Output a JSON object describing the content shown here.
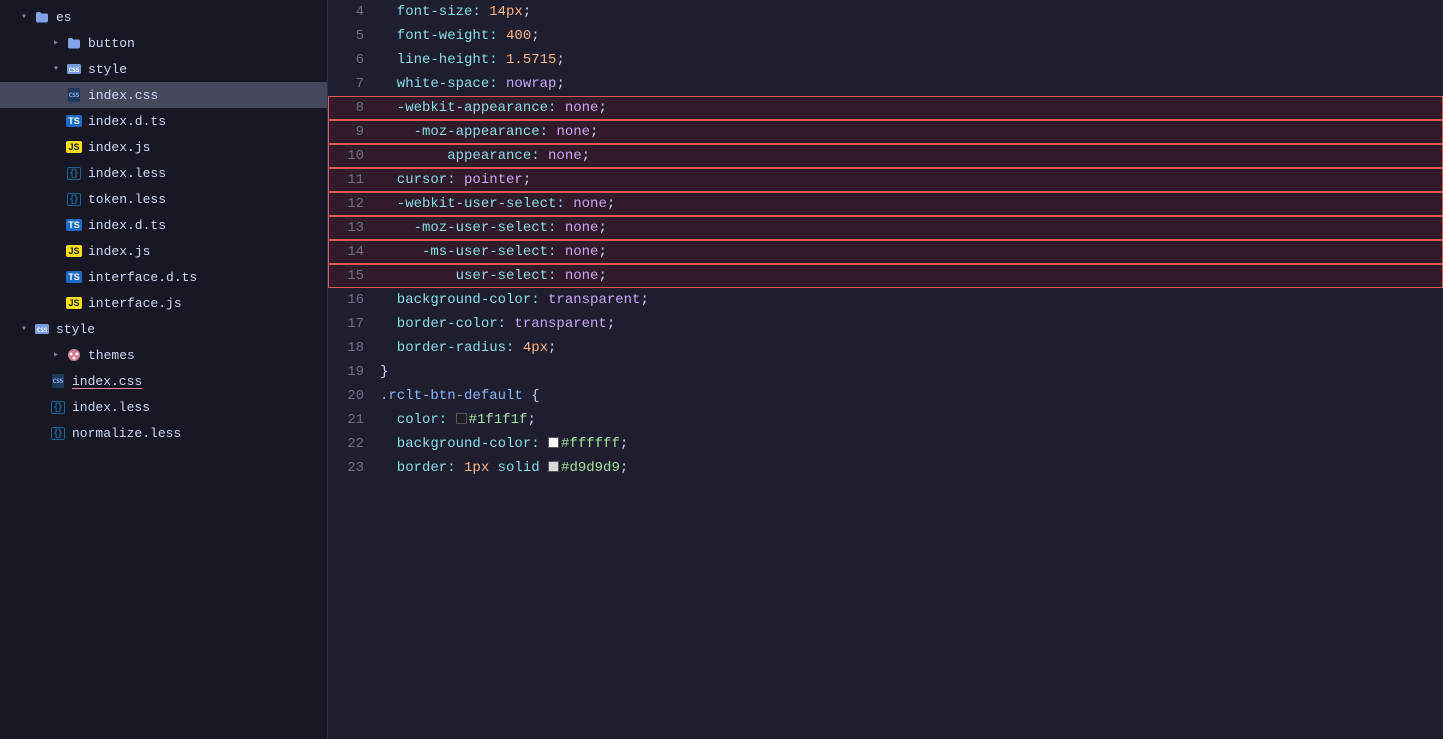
{
  "sidebar": {
    "items": [
      {
        "id": "es-folder",
        "label": "es",
        "type": "folder",
        "icon": "folder",
        "indent": 1,
        "state": "open",
        "depth": 1
      },
      {
        "id": "button-folder",
        "label": "button",
        "type": "folder",
        "icon": "folder",
        "indent": 2,
        "state": "closed",
        "depth": 2
      },
      {
        "id": "style-folder-1",
        "label": "style",
        "type": "folder",
        "icon": "folder-css",
        "indent": 2,
        "state": "open",
        "depth": 2
      },
      {
        "id": "index-css-1",
        "label": "index.css",
        "type": "css",
        "icon": "css",
        "indent": 3,
        "active": true,
        "depth": 3
      },
      {
        "id": "index-d-ts-1",
        "label": "index.d.ts",
        "type": "ts",
        "icon": "ts",
        "indent": 3,
        "depth": 3
      },
      {
        "id": "index-js-1",
        "label": "index.js",
        "type": "js",
        "icon": "js",
        "indent": 3,
        "depth": 3
      },
      {
        "id": "index-less-1",
        "label": "index.less",
        "type": "less",
        "icon": "less",
        "indent": 3,
        "depth": 3
      },
      {
        "id": "token-less-1",
        "label": "token.less",
        "type": "less",
        "icon": "less",
        "indent": 3,
        "depth": 3
      },
      {
        "id": "index-d-ts-2",
        "label": "index.d.ts",
        "type": "ts",
        "icon": "ts",
        "indent": 3,
        "depth": 3
      },
      {
        "id": "index-js-2",
        "label": "index.js",
        "type": "js",
        "icon": "js",
        "indent": 3,
        "depth": 3
      },
      {
        "id": "interface-d-ts",
        "label": "interface.d.ts",
        "type": "ts",
        "icon": "ts",
        "indent": 3,
        "depth": 3
      },
      {
        "id": "interface-js",
        "label": "interface.js",
        "type": "js",
        "icon": "js",
        "indent": 3,
        "depth": 3
      },
      {
        "id": "style-folder-2",
        "label": "style",
        "type": "folder",
        "icon": "folder-css",
        "indent": 1,
        "state": "open",
        "depth": 1
      },
      {
        "id": "themes-folder",
        "label": "themes",
        "type": "folder",
        "icon": "themes",
        "indent": 2,
        "state": "closed",
        "depth": 2
      },
      {
        "id": "index-css-2",
        "label": "index.css",
        "type": "css",
        "icon": "css",
        "indent": 2,
        "underline": true,
        "depth": 2
      },
      {
        "id": "index-less-2",
        "label": "index.less",
        "type": "less",
        "icon": "less",
        "indent": 2,
        "depth": 2
      },
      {
        "id": "normalize-less",
        "label": "normalize.less",
        "type": "less",
        "icon": "less",
        "indent": 2,
        "depth": 2
      }
    ]
  },
  "editor": {
    "lines": [
      {
        "num": 4,
        "tokens": [
          {
            "text": "  font-size: ",
            "class": "prop"
          },
          {
            "text": "14px",
            "class": "val-num"
          },
          {
            "text": ";",
            "class": "semicolon"
          }
        ]
      },
      {
        "num": 5,
        "tokens": [
          {
            "text": "  font-weight: ",
            "class": "prop"
          },
          {
            "text": "400",
            "class": "val-num"
          },
          {
            "text": ";",
            "class": "semicolon"
          }
        ]
      },
      {
        "num": 6,
        "tokens": [
          {
            "text": "  line-height: ",
            "class": "prop"
          },
          {
            "text": "1.5715",
            "class": "val-num"
          },
          {
            "text": ";",
            "class": "semicolon"
          }
        ]
      },
      {
        "num": 7,
        "tokens": [
          {
            "text": "  white-space: ",
            "class": "prop"
          },
          {
            "text": "nowrap",
            "class": "val-none"
          },
          {
            "text": ";",
            "class": "semicolon"
          }
        ]
      },
      {
        "num": 8,
        "tokens": [
          {
            "text": "  -webkit-appearance: ",
            "class": "prop"
          },
          {
            "text": "none",
            "class": "val-none"
          },
          {
            "text": ";",
            "class": "semicolon"
          }
        ],
        "highlight": true
      },
      {
        "num": 9,
        "tokens": [
          {
            "text": "    -moz-appearance: ",
            "class": "prop"
          },
          {
            "text": "none",
            "class": "val-none"
          },
          {
            "text": ";",
            "class": "semicolon"
          }
        ],
        "highlight": true
      },
      {
        "num": 10,
        "tokens": [
          {
            "text": "        appearance: ",
            "class": "prop"
          },
          {
            "text": "none",
            "class": "val-none"
          },
          {
            "text": ";",
            "class": "semicolon"
          }
        ],
        "highlight": true
      },
      {
        "num": 11,
        "tokens": [
          {
            "text": "  cursor: ",
            "class": "prop"
          },
          {
            "text": "pointer",
            "class": "val-none"
          },
          {
            "text": ";",
            "class": "semicolon"
          }
        ],
        "highlight": true
      },
      {
        "num": 12,
        "tokens": [
          {
            "text": "  -webkit-user-select: ",
            "class": "prop"
          },
          {
            "text": "none",
            "class": "val-none"
          },
          {
            "text": ";",
            "class": "semicolon"
          }
        ],
        "highlight": true
      },
      {
        "num": 13,
        "tokens": [
          {
            "text": "    -moz-user-select: ",
            "class": "prop"
          },
          {
            "text": "none",
            "class": "val-none"
          },
          {
            "text": ";",
            "class": "semicolon"
          }
        ],
        "highlight": true
      },
      {
        "num": 14,
        "tokens": [
          {
            "text": "     -ms-user-select: ",
            "class": "prop"
          },
          {
            "text": "none",
            "class": "val-none"
          },
          {
            "text": ";",
            "class": "semicolon"
          }
        ],
        "highlight": true
      },
      {
        "num": 15,
        "tokens": [
          {
            "text": "         user-select: ",
            "class": "prop"
          },
          {
            "text": "none",
            "class": "val-none"
          },
          {
            "text": ";",
            "class": "semicolon"
          }
        ],
        "highlight": true
      },
      {
        "num": 16,
        "tokens": [
          {
            "text": "  background-color: ",
            "class": "prop"
          },
          {
            "text": "transparent",
            "class": "val-none"
          },
          {
            "text": ";",
            "class": "semicolon"
          }
        ]
      },
      {
        "num": 17,
        "tokens": [
          {
            "text": "  border-color: ",
            "class": "prop"
          },
          {
            "text": "transparent",
            "class": "val-none"
          },
          {
            "text": ";",
            "class": "semicolon"
          }
        ]
      },
      {
        "num": 18,
        "tokens": [
          {
            "text": "  border-radius: ",
            "class": "prop"
          },
          {
            "text": "4px",
            "class": "val-num"
          },
          {
            "text": ";",
            "class": "semicolon"
          }
        ]
      },
      {
        "num": 19,
        "tokens": [
          {
            "text": "}",
            "class": "brace"
          }
        ]
      },
      {
        "num": 20,
        "tokens": [
          {
            "text": ".rclt-btn-default ",
            "class": "selector"
          },
          {
            "text": "{",
            "class": "brace"
          }
        ]
      },
      {
        "num": 21,
        "tokens": [
          {
            "text": "  color: ",
            "class": "prop"
          },
          {
            "text": "SWATCH:#1f1f1f",
            "class": "val-hash"
          },
          {
            "text": "#1f1f1f",
            "class": "val-hash"
          },
          {
            "text": ";",
            "class": "semicolon"
          }
        ]
      },
      {
        "num": 22,
        "tokens": [
          {
            "text": "  background-color: ",
            "class": "prop"
          },
          {
            "text": "SWATCH:#ffffff",
            "class": "val-hash"
          },
          {
            "text": "#ffffff",
            "class": "val-hash"
          },
          {
            "text": ";",
            "class": "semicolon"
          }
        ]
      },
      {
        "num": 23,
        "tokens": [
          {
            "text": "  border: ",
            "class": "prop"
          },
          {
            "text": "1px",
            "class": "val-num"
          },
          {
            "text": " solid ",
            "class": "prop"
          },
          {
            "text": "SWATCH:#d9d9d9",
            "class": "val-hash"
          },
          {
            "text": "#d9d9d9",
            "class": "val-hash"
          },
          {
            "text": ";",
            "class": "semicolon"
          }
        ]
      }
    ]
  }
}
